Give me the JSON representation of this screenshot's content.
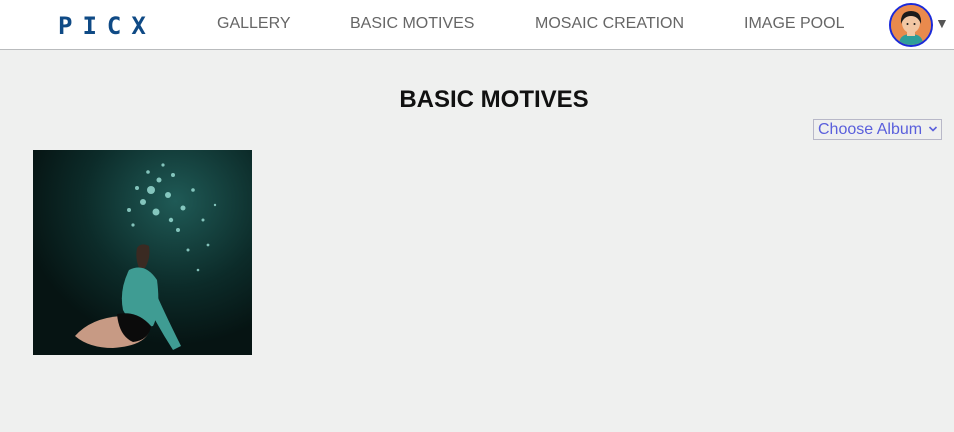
{
  "brand": {
    "logo_letters": [
      "P",
      "I",
      "C",
      "X"
    ]
  },
  "nav": {
    "items": [
      "GALLERY",
      "BASIC MOTIVES",
      "MOSAIC CREATION",
      "IMAGE POOL"
    ]
  },
  "user_menu": {
    "caret": "▼"
  },
  "main": {
    "title": "BASIC MOTIVES",
    "album_select": {
      "selected": "Choose Album"
    }
  },
  "colors": {
    "brand": "#0f4a85",
    "nav_text": "#666666",
    "select_text": "#5a5fdc",
    "background": "#eff0ef",
    "avatar_border": "#1a2ad9"
  },
  "icons": {
    "avatar": "user-avatar-icon",
    "dropdown": "chevron-down-icon"
  }
}
